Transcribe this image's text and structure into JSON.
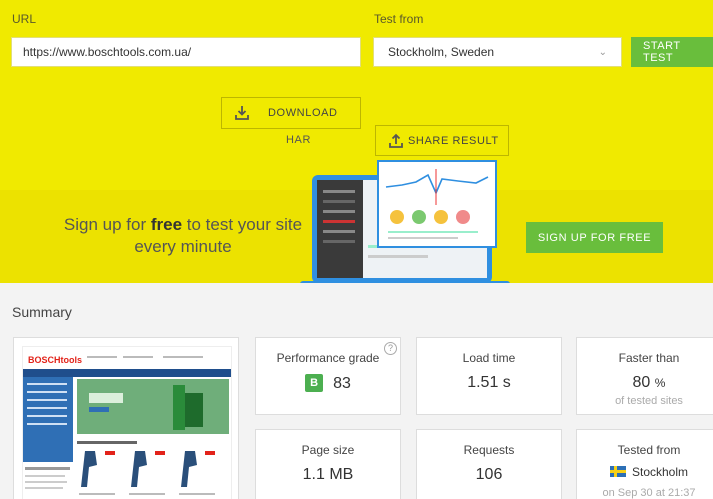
{
  "form": {
    "url_label": "URL",
    "url_value": "https://www.boschtools.com.ua/",
    "location_label": "Test from",
    "location_value": "Stockholm, Sweden",
    "start_button": "START TEST"
  },
  "actions": {
    "download_label": "DOWNLOAD",
    "har_label": "HAR",
    "share_label": "SHARE RESULT"
  },
  "promo": {
    "text_before": "Sign up for ",
    "text_bold": "free",
    "text_after": " to test your site every minute",
    "signup_button": "SIGN UP FOR FREE"
  },
  "summary": {
    "title": "Summary",
    "performance": {
      "label": "Performance grade",
      "grade": "B",
      "score": "83",
      "help": "?"
    },
    "load_time": {
      "label": "Load time",
      "value": "1.51 s"
    },
    "faster_than": {
      "label": "Faster than",
      "value": "80",
      "unit": "%",
      "sub": "of tested sites"
    },
    "page_size": {
      "label": "Page size",
      "value": "1.1 MB"
    },
    "requests": {
      "label": "Requests",
      "value": "106"
    },
    "tested_from": {
      "label": "Tested from",
      "value": "Stockholm",
      "sub": "on Sep 30 at 21:37"
    }
  },
  "screenshot": {
    "logo_text": "BOSCHtools"
  },
  "icons": {
    "download": "download-icon",
    "share": "share-icon",
    "select": "chevron-down-icon",
    "flag": "sweden-flag-icon"
  },
  "colors": {
    "accent_yellow": "#f0ea00",
    "button_green": "#69be3c",
    "grade_green": "#4caf50"
  }
}
